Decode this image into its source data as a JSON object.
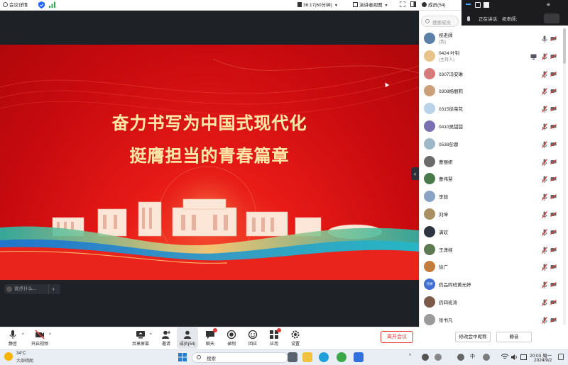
{
  "topbar": {
    "meeting_info": "会议详情",
    "timer": "36:17(60分钟)",
    "view_mode": "演讲者视图",
    "members": "成员(54)"
  },
  "slide": {
    "line1": "奋力书写为中国式现代化",
    "line2": "挺膺担当的青春篇章"
  },
  "chat_input": {
    "placeholder": "说点什么..."
  },
  "overlay": {
    "speaking_label": "正在讲话:",
    "speaker": "祝老師;"
  },
  "panel": {
    "search_placeholder": "搜索成员",
    "members": [
      {
        "name": "祝老師",
        "role": "(我)",
        "avatar_color": "#5b7fa6"
      },
      {
        "name": "0424 叶钊",
        "role": "(主持人)",
        "avatar_color": "#e8c48a"
      },
      {
        "name": "0307冯安琳",
        "role": "",
        "avatar_color": "#d97a7a"
      },
      {
        "name": "0308杨丽莉",
        "role": "",
        "avatar_color": "#c9a07a"
      },
      {
        "name": "0315徐荣花",
        "role": "",
        "avatar_color": "#b9d3e8"
      },
      {
        "name": "0410吴甜甜",
        "role": "",
        "avatar_color": "#7a6fb0"
      },
      {
        "name": "0538彭蓉",
        "role": "",
        "avatar_color": "#9eb7c9"
      },
      {
        "name": "曹丽妍",
        "role": "",
        "avatar_color": "#6b6b6b"
      },
      {
        "name": "曹伟慧",
        "role": "",
        "avatar_color": "#4a7a4a"
      },
      {
        "name": "李喆",
        "role": "",
        "avatar_color": "#8aa3c4"
      },
      {
        "name": "刘坤",
        "role": "",
        "avatar_color": "#a98f62"
      },
      {
        "name": "满欢",
        "role": "",
        "avatar_color": "#2e3440"
      },
      {
        "name": "王潇桂",
        "role": "",
        "avatar_color": "#5d7a52"
      },
      {
        "name": "徐广",
        "role": "",
        "avatar_color": "#c47b3e"
      },
      {
        "name": "药品四班黄元婷",
        "role": "",
        "avatar_color": "#3f6fd1",
        "avatar_text": "元婷"
      },
      {
        "name": "药四班涛",
        "role": "",
        "avatar_color": "#7b5a4a"
      },
      {
        "name": "张书凡",
        "role": "",
        "avatar_color": "#9a9a9a"
      }
    ],
    "rename_button": "修改会中昵称",
    "mute_button": "静音"
  },
  "toolbar": {
    "mute": "静音",
    "video": "开启视频",
    "share": "共享屏幕",
    "invite": "邀请",
    "members": "成员(54)",
    "chat": "聊天",
    "record": "录制",
    "review": "回应",
    "apps": "应用",
    "settings": "设置",
    "leave": "离开会议"
  },
  "taskbar": {
    "temperature": "34°C",
    "weather": "大部晴朗",
    "search": "搜索",
    "ime": "中",
    "time": "20:03 周一",
    "date": "2024/9/2"
  },
  "colors": {
    "accent": "#e53935",
    "blue": "#1e66f5",
    "slide_red": "#d81212",
    "gold": "#f6c97a"
  }
}
